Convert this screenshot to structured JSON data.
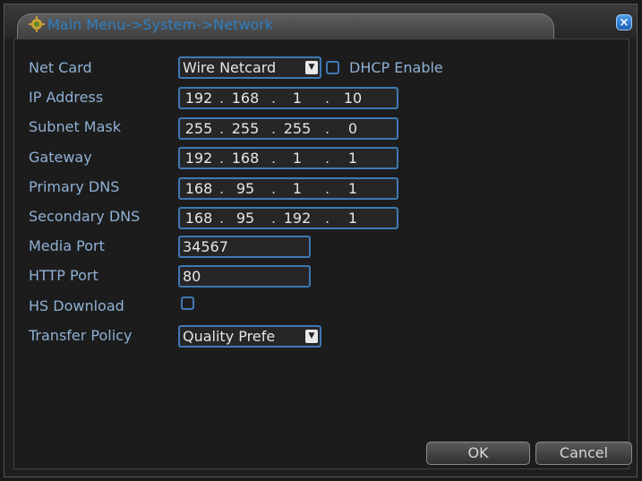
{
  "window": {
    "title": "Main Menu->System->Network",
    "close_label": "×"
  },
  "labels": {
    "net_card": "Net Card",
    "ip_address": "IP Address",
    "subnet_mask": "Subnet Mask",
    "gateway": "Gateway",
    "primary_dns": "Primary DNS",
    "secondary_dns": "Secondary DNS",
    "media_port": "Media Port",
    "http_port": "HTTP Port",
    "hs_download": "HS Download",
    "transfer_policy": "Transfer Policy",
    "dhcp_enable": "DHCP Enable"
  },
  "values": {
    "net_card": "Wire Netcard",
    "ip_address": [
      "192",
      "168",
      "1",
      "10"
    ],
    "subnet_mask": [
      "255",
      "255",
      "255",
      "0"
    ],
    "gateway": [
      "192",
      "168",
      "1",
      "1"
    ],
    "primary_dns": [
      "168",
      "95",
      "1",
      "1"
    ],
    "secondary_dns": [
      "168",
      "95",
      "192",
      "1"
    ],
    "media_port": "34567",
    "http_port": "80",
    "transfer_policy": "Quality Prefe",
    "dhcp_enabled": false,
    "hs_download_enabled": false
  },
  "buttons": {
    "ok": "OK",
    "cancel": "Cancel"
  },
  "icons": {
    "title_icon": "settings-gear-icon",
    "dropdown_arrow": "▼"
  },
  "colors": {
    "accent": "#3f78b4",
    "label": "#8fb0d4",
    "title": "#2f7fc2"
  }
}
